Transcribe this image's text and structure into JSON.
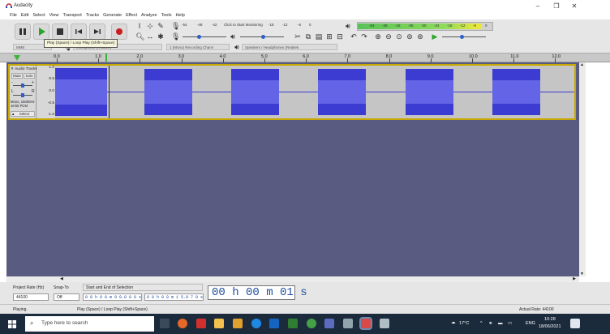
{
  "window": {
    "title": "Audacity",
    "minimize": "–",
    "maximize": "❐",
    "close": "✕"
  },
  "menu": [
    "File",
    "Edit",
    "Select",
    "View",
    "Transport",
    "Tracks",
    "Generate",
    "Effect",
    "Analyze",
    "Tools",
    "Help"
  ],
  "transport": {
    "pause_icon": "pause-icon",
    "play_icon": "play-icon",
    "stop_icon": "stop-icon",
    "skip_start_icon": "skip-to-start-icon",
    "skip_end_icon": "skip-to-end-icon",
    "record_icon": "record-icon",
    "tooltip": "Play (Space) / Loop Play (Shift+Space)"
  },
  "meters": {
    "record_scale": [
      "-54",
      "-48",
      "-42",
      "Click to Start Monitoring",
      "-18",
      "-12",
      "-6",
      "0"
    ],
    "playback_scale": [
      "-54",
      "-48",
      "-42",
      "-36",
      "-30",
      "-24",
      "-18",
      "-12",
      "-6",
      "0"
    ],
    "playback_level_fraction": 0.92
  },
  "devices": {
    "host": "MME",
    "recording_device": "Microphone (Realtek)",
    "channels": "1 (Mono) Recording Chann",
    "playback_device": "Speakers / Headphones (Realtek"
  },
  "ruler": {
    "ticks": [
      "0.0",
      "1.0",
      "2.0",
      "3.0",
      "4.0",
      "5.0",
      "6.0",
      "7.0",
      "8.0",
      "9.0",
      "10.0",
      "11.0",
      "12.0"
    ]
  },
  "track": {
    "name": "Audio Track",
    "mute": "Mute",
    "solo": "Solo",
    "gain_left": "-",
    "gain_right": "+",
    "pan_left": "L",
    "pan_right": "R",
    "info": "Mono, 16000Hz\n16-bit PCM",
    "select": "Select",
    "scale": [
      "1.0",
      "0.5",
      "0.0",
      "-0.5",
      "-1.0"
    ]
  },
  "selection_toolbar": {
    "project_rate_label": "Project Rate (Hz)",
    "project_rate_value": "44100",
    "snap_label": "Snap-To",
    "snap_value": "Off",
    "selection_label": "Start and End of Selection",
    "start_time": "0 0 h 0 0 m 0 0.0 0 0 s",
    "end_time": "0 0 h 0 0 m 1 5.9 7 9 s",
    "big_time": "00 h 00 m 01 s"
  },
  "status": {
    "state": "Playing.",
    "hint": "Play (Space) / Loop Play (Shift+Space)",
    "rate": "Actual Rate: 44100"
  },
  "taskbar": {
    "search_placeholder": "Type here to search",
    "temperature": "17°C",
    "language": "ENG",
    "time": "10:28",
    "date": "18/06/2021"
  },
  "colors": {
    "waveform": "#3c3cd2",
    "waveform_rms": "#6464e6",
    "track_border": "#c8a800",
    "track_bg": "#595c80",
    "taskbar": "#1c2b3c"
  }
}
